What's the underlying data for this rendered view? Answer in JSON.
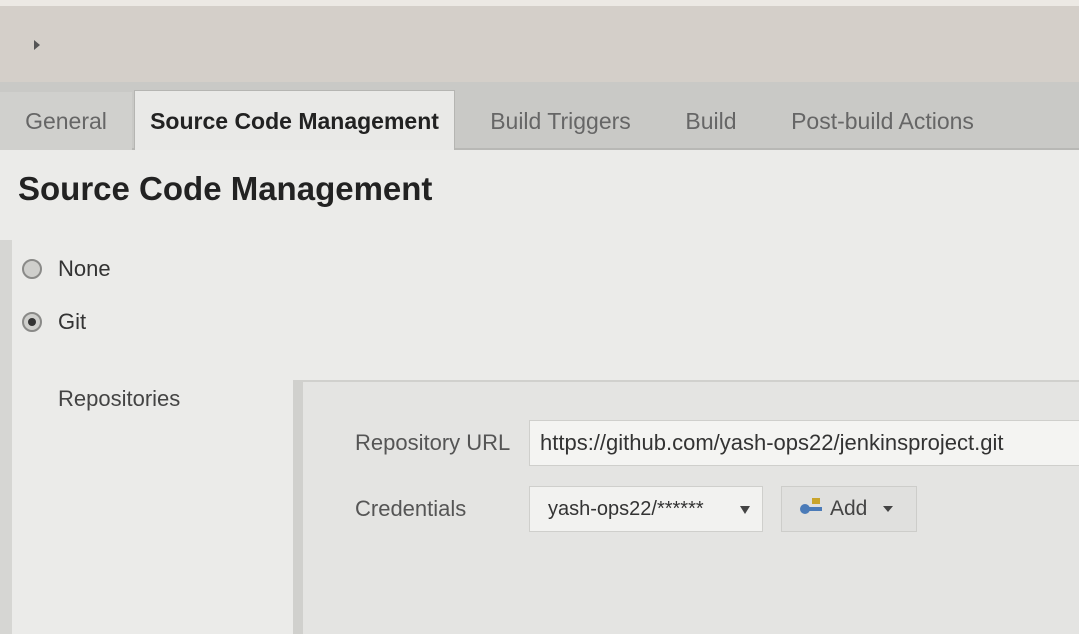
{
  "tabs": [
    {
      "label": "General"
    },
    {
      "label": "Source Code Management"
    },
    {
      "label": "Build Triggers"
    },
    {
      "label": "Build"
    },
    {
      "label": "Post-build Actions"
    }
  ],
  "section": {
    "title": "Source Code Management"
  },
  "scm": {
    "options": [
      {
        "label": "None",
        "selected": false
      },
      {
        "label": "Git",
        "selected": true
      }
    ],
    "repositories_label": "Repositories",
    "repository_url_label": "Repository URL",
    "repository_url_value": "https://github.com/yash-ops22/jenkinsproject.git",
    "credentials_label": "Credentials",
    "credentials_value": "yash-ops22/******",
    "add_label": "Add"
  },
  "icons": {
    "breadcrumb": "chevron-right-icon",
    "add": "key-icon",
    "credentials_dropdown": "chevron-down-icon"
  },
  "colors": {
    "active_tab_bg": "#e9e9e7",
    "tab_bar_bg": "#c9c9c6",
    "key_icon": "#4b7bb8"
  }
}
